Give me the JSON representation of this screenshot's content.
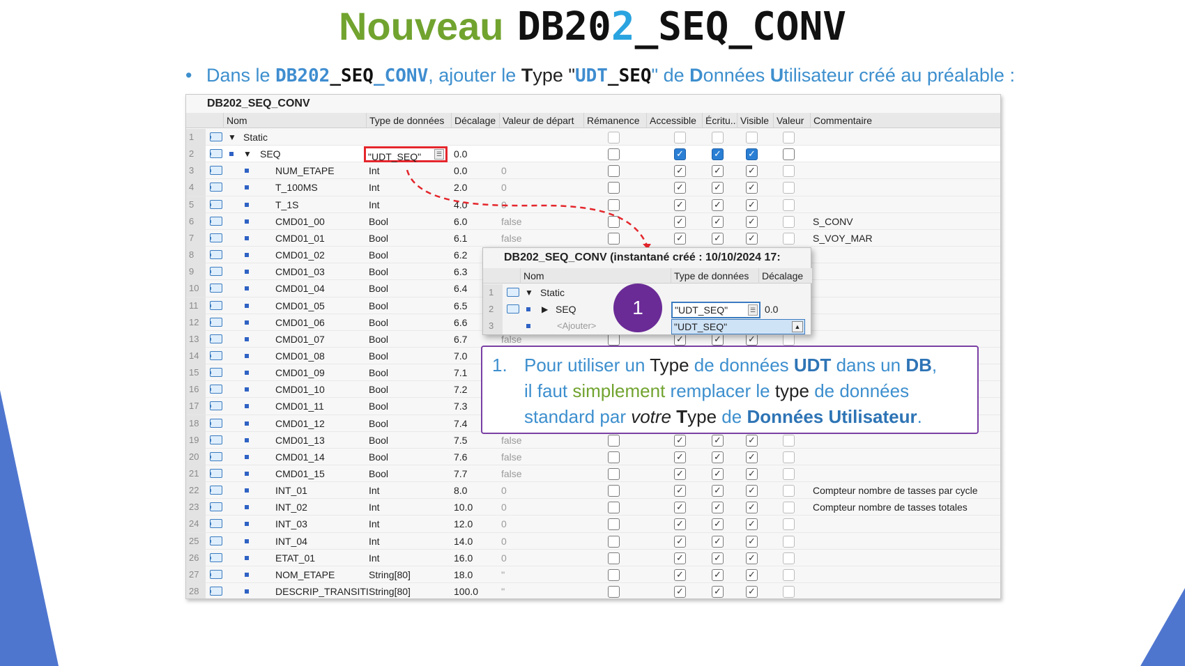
{
  "title": {
    "part1": "Nouveau",
    "part2a": "DB20",
    "part2b": "2",
    "part2c": "_SEQ_CONV"
  },
  "bullet": {
    "t1": "Dans le ",
    "db_a": "DB202",
    "db_b": "_SEQ",
    "db_c": "_CONV",
    "t2": ", ajouter le ",
    "T": "T",
    "ype": "ype \"",
    "udt_a": "UDT",
    "udt_b": "_SEQ",
    "t3": "\" de ",
    "D": "D",
    "onnees": "onnées ",
    "U": "U",
    "tilisateur": "tilisateur créé au préalable :"
  },
  "grid": {
    "title": "DB202_SEQ_CONV",
    "headers": [
      "Nom",
      "Type de données",
      "Décalage",
      "Valeur de départ",
      "Rémanence",
      "Accessible",
      "Écritu...",
      "Visible",
      "Valeur",
      "Commentaire"
    ],
    "rows": [
      {
        "n": "1",
        "name": "Static",
        "type": "",
        "offset": "",
        "start": "",
        "comment": ""
      },
      {
        "n": "2",
        "name": "SEQ",
        "type": "\"UDT_SEQ\"",
        "offset": "0.0",
        "start": "",
        "comment": ""
      },
      {
        "n": "3",
        "name": "NUM_ETAPE",
        "type": "Int",
        "offset": "0.0",
        "start": "0",
        "comment": ""
      },
      {
        "n": "4",
        "name": "T_100MS",
        "type": "Int",
        "offset": "2.0",
        "start": "0",
        "comment": ""
      },
      {
        "n": "5",
        "name": "T_1S",
        "type": "Int",
        "offset": "4.0",
        "start": "0",
        "comment": ""
      },
      {
        "n": "6",
        "name": "CMD01_00",
        "type": "Bool",
        "offset": "6.0",
        "start": "false",
        "comment": "S_CONV"
      },
      {
        "n": "7",
        "name": "CMD01_01",
        "type": "Bool",
        "offset": "6.1",
        "start": "false",
        "comment": "S_VOY_MAR"
      },
      {
        "n": "8",
        "name": "CMD01_02",
        "type": "Bool",
        "offset": "6.2",
        "start": "",
        "comment": ""
      },
      {
        "n": "9",
        "name": "CMD01_03",
        "type": "Bool",
        "offset": "6.3",
        "start": "",
        "comment": ""
      },
      {
        "n": "10",
        "name": "CMD01_04",
        "type": "Bool",
        "offset": "6.4",
        "start": "",
        "comment": ""
      },
      {
        "n": "11",
        "name": "CMD01_05",
        "type": "Bool",
        "offset": "6.5",
        "start": "",
        "comment": ""
      },
      {
        "n": "12",
        "name": "CMD01_06",
        "type": "Bool",
        "offset": "6.6",
        "start": "",
        "comment": ""
      },
      {
        "n": "13",
        "name": "CMD01_07",
        "type": "Bool",
        "offset": "6.7",
        "start": "false",
        "comment": ""
      },
      {
        "n": "14",
        "name": "CMD01_08",
        "type": "Bool",
        "offset": "7.0",
        "start": "",
        "comment": ""
      },
      {
        "n": "15",
        "name": "CMD01_09",
        "type": "Bool",
        "offset": "7.1",
        "start": "",
        "comment": ""
      },
      {
        "n": "16",
        "name": "CMD01_10",
        "type": "Bool",
        "offset": "7.2",
        "start": "",
        "comment": ""
      },
      {
        "n": "17",
        "name": "CMD01_11",
        "type": "Bool",
        "offset": "7.3",
        "start": "",
        "comment": ""
      },
      {
        "n": "18",
        "name": "CMD01_12",
        "type": "Bool",
        "offset": "7.4",
        "start": "",
        "comment": ""
      },
      {
        "n": "19",
        "name": "CMD01_13",
        "type": "Bool",
        "offset": "7.5",
        "start": "false",
        "comment": ""
      },
      {
        "n": "20",
        "name": "CMD01_14",
        "type": "Bool",
        "offset": "7.6",
        "start": "false",
        "comment": ""
      },
      {
        "n": "21",
        "name": "CMD01_15",
        "type": "Bool",
        "offset": "7.7",
        "start": "false",
        "comment": ""
      },
      {
        "n": "22",
        "name": "INT_01",
        "type": "Int",
        "offset": "8.0",
        "start": "0",
        "comment": "Compteur nombre de tasses par cycle"
      },
      {
        "n": "23",
        "name": "INT_02",
        "type": "Int",
        "offset": "10.0",
        "start": "0",
        "comment": "Compteur nombre de tasses totales"
      },
      {
        "n": "24",
        "name": "INT_03",
        "type": "Int",
        "offset": "12.0",
        "start": "0",
        "comment": ""
      },
      {
        "n": "25",
        "name": "INT_04",
        "type": "Int",
        "offset": "14.0",
        "start": "0",
        "comment": ""
      },
      {
        "n": "26",
        "name": "ETAT_01",
        "type": "Int",
        "offset": "16.0",
        "start": "0",
        "comment": ""
      },
      {
        "n": "27",
        "name": "NOM_ETAPE",
        "type": "String[80]",
        "offset": "18.0",
        "start": "''",
        "comment": ""
      },
      {
        "n": "28",
        "name": "DESCRIP_TRANSITI",
        "type": "String[80]",
        "offset": "100.0",
        "start": "''",
        "comment": ""
      }
    ]
  },
  "popup": {
    "title": "DB202_SEQ_CONV (instantané créé : 10/10/2024 17:",
    "headers": [
      "Nom",
      "Type de données",
      "Décalage"
    ],
    "rows": [
      {
        "n": "1",
        "name": "Static"
      },
      {
        "n": "2",
        "name": "SEQ",
        "type": "\"UDT_SEQ\"",
        "offset": "0.0"
      },
      {
        "n": "3",
        "name": "<Ajouter>"
      }
    ],
    "dropdown_option": "\"UDT_SEQ\""
  },
  "badge": "1",
  "note": {
    "num": "1.",
    "s1": "Pour utiliser un ",
    "s2": "Type",
    "s3": " de données ",
    "s4": "UDT",
    "s5": " dans un ",
    "s6": "DB",
    "s7": ",",
    "s8": "il faut ",
    "s9": "simplement",
    "s10": " remplacer le ",
    "s11": "type",
    "s12": " de données",
    "s13": "standard par ",
    "s14": "votre",
    "s15": " T",
    "s16": "ype",
    "s17": " de ",
    "s18": "Données Utilisateur",
    "s19": "."
  },
  "colors": {
    "accent_blue": "#3d8fce",
    "green": "#71a32f",
    "purple": "#6a2b96",
    "red": "#e4262c",
    "shape_blue": "#4f76cf"
  }
}
